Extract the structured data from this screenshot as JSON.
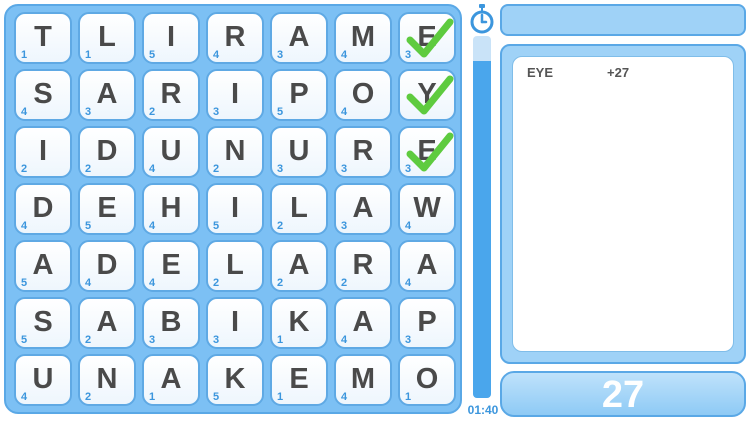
{
  "grid": [
    [
      {
        "l": "T",
        "s": "1"
      },
      {
        "l": "L",
        "s": "1"
      },
      {
        "l": "I",
        "s": "5"
      },
      {
        "l": "R",
        "s": "4"
      },
      {
        "l": "A",
        "s": "3"
      },
      {
        "l": "M",
        "s": "4"
      },
      {
        "l": "E",
        "s": "3",
        "checked": true
      }
    ],
    [
      {
        "l": "S",
        "s": "4"
      },
      {
        "l": "A",
        "s": "3"
      },
      {
        "l": "R",
        "s": "2"
      },
      {
        "l": "I",
        "s": "3"
      },
      {
        "l": "P",
        "s": "5"
      },
      {
        "l": "O",
        "s": "4"
      },
      {
        "l": "Y",
        "s": "",
        "checked": true
      }
    ],
    [
      {
        "l": "I",
        "s": "2"
      },
      {
        "l": "D",
        "s": "2"
      },
      {
        "l": "U",
        "s": "4"
      },
      {
        "l": "N",
        "s": "2"
      },
      {
        "l": "U",
        "s": "3"
      },
      {
        "l": "R",
        "s": "3"
      },
      {
        "l": "E",
        "s": "3",
        "checked": true
      }
    ],
    [
      {
        "l": "D",
        "s": "4"
      },
      {
        "l": "E",
        "s": "5"
      },
      {
        "l": "H",
        "s": "4"
      },
      {
        "l": "I",
        "s": "5"
      },
      {
        "l": "L",
        "s": "2"
      },
      {
        "l": "A",
        "s": "3"
      },
      {
        "l": "W",
        "s": "4"
      }
    ],
    [
      {
        "l": "A",
        "s": "5"
      },
      {
        "l": "D",
        "s": "4"
      },
      {
        "l": "E",
        "s": "4"
      },
      {
        "l": "L",
        "s": "2"
      },
      {
        "l": "A",
        "s": "2"
      },
      {
        "l": "R",
        "s": "2"
      },
      {
        "l": "A",
        "s": "4"
      }
    ],
    [
      {
        "l": "S",
        "s": "5"
      },
      {
        "l": "A",
        "s": "2"
      },
      {
        "l": "B",
        "s": "3"
      },
      {
        "l": "I",
        "s": "3"
      },
      {
        "l": "K",
        "s": "1"
      },
      {
        "l": "A",
        "s": "4"
      },
      {
        "l": "P",
        "s": "3"
      }
    ],
    [
      {
        "l": "U",
        "s": "4"
      },
      {
        "l": "N",
        "s": "2"
      },
      {
        "l": "A",
        "s": "1"
      },
      {
        "l": "K",
        "s": "5"
      },
      {
        "l": "E",
        "s": "1"
      },
      {
        "l": "M",
        "s": "4"
      },
      {
        "l": "O",
        "s": "1"
      }
    ]
  ],
  "timer": {
    "text": "01:40",
    "remaining": 0.93
  },
  "found_words": [
    {
      "word": "EYE",
      "points": "+27"
    }
  ],
  "score": "27",
  "colors": {
    "board": "#7cc0f4",
    "accent": "#3c96dd",
    "check": "#5ecb3f"
  }
}
